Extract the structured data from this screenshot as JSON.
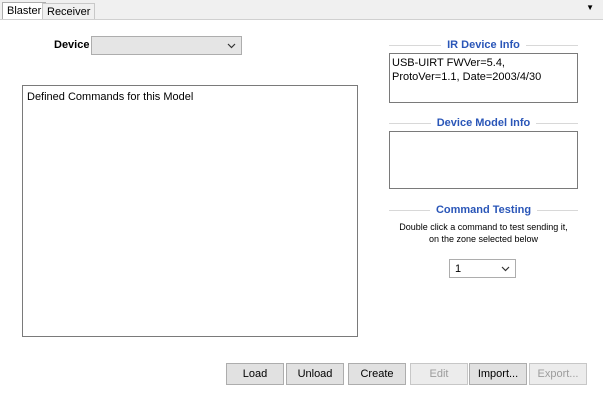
{
  "tabs": [
    {
      "label": "Blaster",
      "active": true
    },
    {
      "label": "Receiver",
      "active": false
    }
  ],
  "overflow_icon": "triangle-down",
  "device": {
    "label": "Device",
    "value": ""
  },
  "commands": {
    "header": "Defined Commands for this Model"
  },
  "ir_device_info": {
    "title": "IR Device Info",
    "text": "USB-UIRT FWVer=5.4, ProtoVer=1.1, Date=2003/4/30"
  },
  "device_model_info": {
    "title": "Device Model Info",
    "text": ""
  },
  "command_testing": {
    "title": "Command Testing",
    "hint": "Double click a command to test sending it, on the zone selected below",
    "zone_value": "1"
  },
  "buttons": {
    "load": "Load",
    "unload": "Unload",
    "create": "Create",
    "edit": "Edit",
    "import": "Import...",
    "export": "Export..."
  },
  "colors": {
    "group_title": "#2a56b8",
    "disabled_text": "#9c9c9c"
  }
}
